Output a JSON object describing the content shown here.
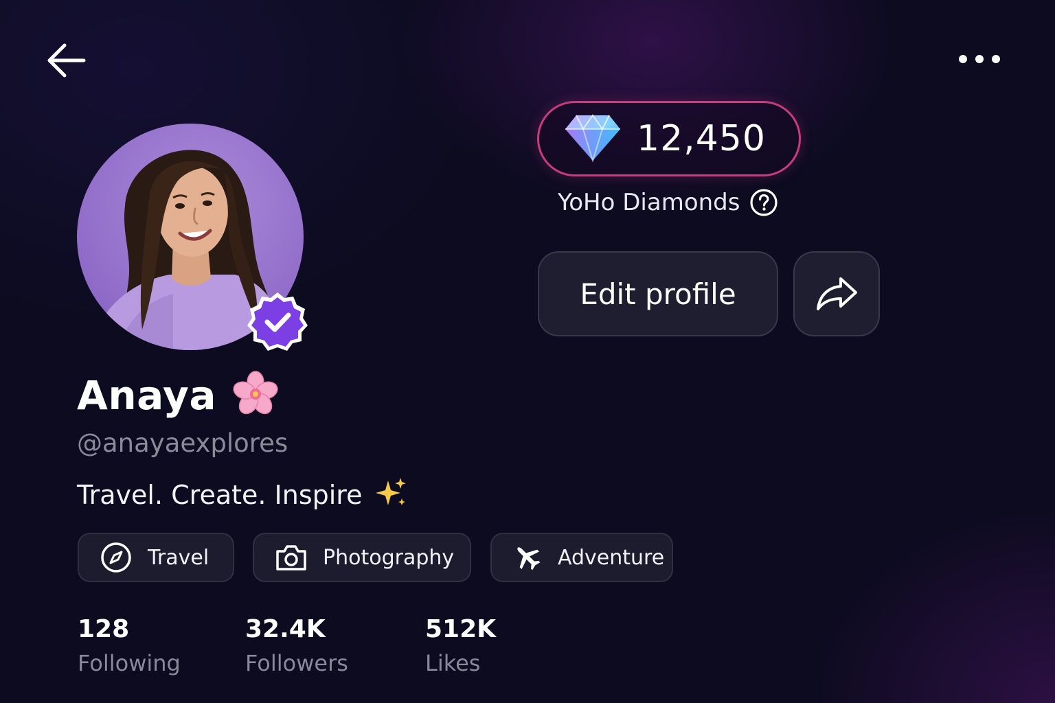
{
  "header": {
    "back_icon": "arrow-left-icon",
    "more_icon": "more-horizontal-icon"
  },
  "profile": {
    "display_name": "Anaya",
    "name_emoji": "🌸",
    "handle": "@anayaexplores",
    "bio": "Travel. Create. Inspire",
    "bio_emoji": "✨",
    "verified": true
  },
  "tags": [
    {
      "label": "Travel",
      "icon": "compass-icon"
    },
    {
      "label": "Photography",
      "icon": "camera-icon"
    },
    {
      "label": "Adventure",
      "icon": "airplane-icon"
    }
  ],
  "stats": [
    {
      "value": "128",
      "label": "Following"
    },
    {
      "value": "32.4K",
      "label": "Followers"
    },
    {
      "value": "512K",
      "label": "Likes"
    }
  ],
  "diamonds": {
    "count": "12,450",
    "caption": "YoHo Diamonds",
    "icon": "diamond-icon"
  },
  "actions": {
    "edit_label": "Edit profile",
    "share_icon": "share-icon"
  },
  "colors": {
    "background": "#0c0b1f",
    "accent_pink": "#c63c7e",
    "verified_purple": "#7b3fe4",
    "muted_text": "#8a899a"
  }
}
